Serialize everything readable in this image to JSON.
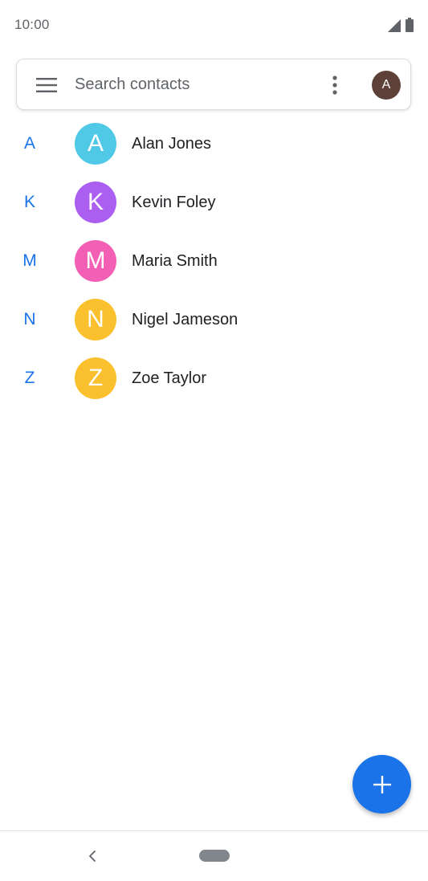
{
  "status_bar": {
    "time": "10:00",
    "icons": [
      "signal-icon",
      "battery-icon"
    ]
  },
  "search": {
    "placeholder": "Search contacts",
    "menu_icon": "menu-icon",
    "more_icon": "more-vert-icon",
    "account_initial": "A",
    "account_color": "#5d4037"
  },
  "contacts": [
    {
      "section": "A",
      "initial": "A",
      "name": "Alan Jones",
      "color": "#4fc9e6"
    },
    {
      "section": "K",
      "initial": "K",
      "name": "Kevin Foley",
      "color": "#ab5ef0"
    },
    {
      "section": "M",
      "initial": "M",
      "name": "Maria Smith",
      "color": "#f25fb5"
    },
    {
      "section": "N",
      "initial": "N",
      "name": "Nigel Jameson",
      "color": "#fbc02d"
    },
    {
      "section": "Z",
      "initial": "Z",
      "name": "Zoe Taylor",
      "color": "#fbc02d"
    }
  ],
  "fab": {
    "icon": "plus-icon",
    "color": "#1a73e8"
  },
  "nav": {
    "back_icon": "back-chevron-icon",
    "home_icon": "home-pill-icon"
  },
  "colors": {
    "accent": "#1a73e8",
    "text_primary": "#202124",
    "text_secondary": "#5f6368"
  }
}
